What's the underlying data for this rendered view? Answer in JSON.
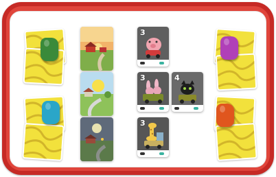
{
  "colors": {
    "frame": "#c62a25",
    "card_yellow": "#f2e13c",
    "token_green": "#3a8a3a",
    "token_blue": "#2aa6c8",
    "token_purple": "#b040b8",
    "token_orange": "#e0561e"
  },
  "vehicle_cards": [
    {
      "number": "3",
      "animal": "pig-icon",
      "bg": "#5f5f5f"
    },
    {
      "number": "3",
      "animal": "rabbits-icon",
      "bg": "#5a5a5a"
    },
    {
      "number": "4",
      "animal": "black-cat-icon",
      "bg": "#6a6a6a"
    },
    {
      "number": "3",
      "animal": "giraffe-icon",
      "bg": "#565656"
    }
  ],
  "scene_cards": [
    {
      "scene": "sunset-farm"
    },
    {
      "scene": "daytime-farm"
    },
    {
      "scene": "night-farm"
    }
  ]
}
